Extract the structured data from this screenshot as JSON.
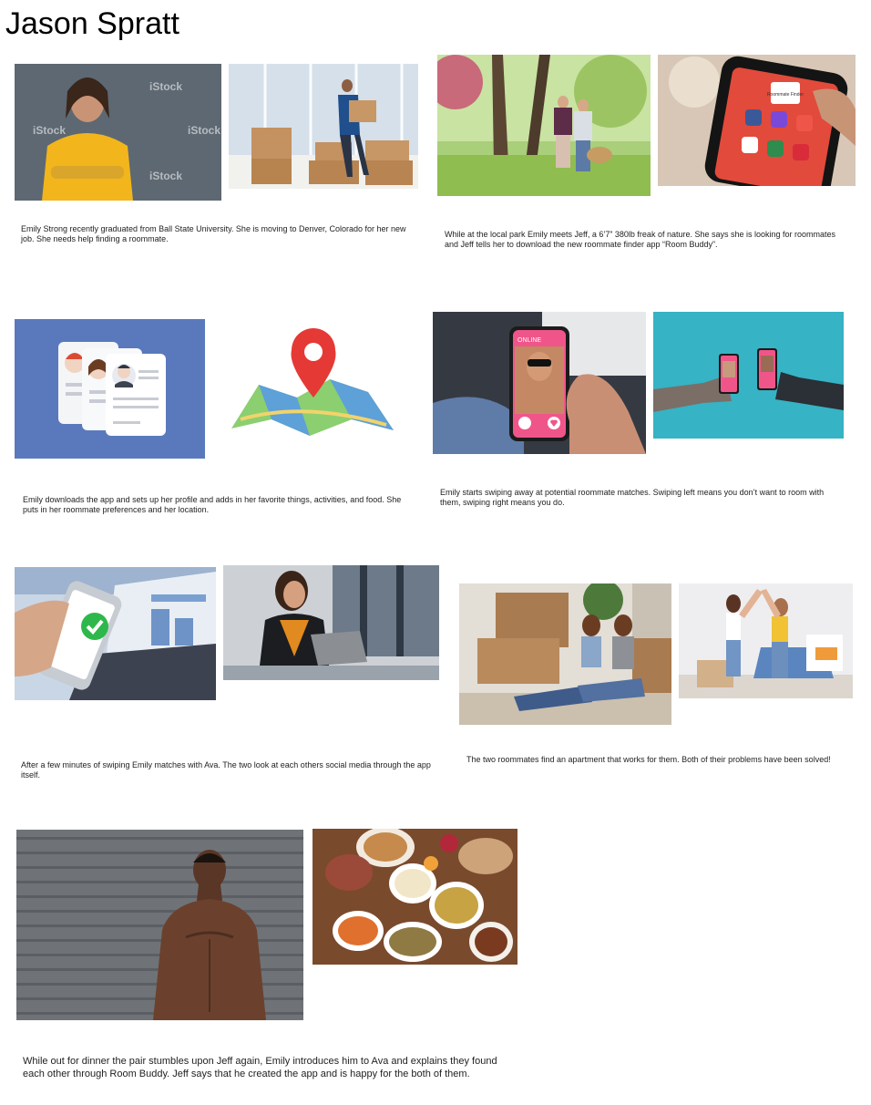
{
  "page": {
    "title": "Jason Spratt"
  },
  "watermark": "iStock",
  "captions": {
    "scene1": "Emily Strong recently graduated from Ball State University. She is moving to Denver, Colorado for her new job. She needs help finding a roommate.",
    "scene2": "While at the local park Emily meets Jeff, a 6’7” 380lb freak of nature. She says she is looking for roommates and Jeff tells her to download the new roommate finder app “Room Buddy”.",
    "scene3": "Emily downloads the app and sets up her profile and adds in her favorite things, activities, and food. She puts in her roommate preferences and her location.",
    "scene4": "Emily starts swiping away at potential roommate matches. Swiping left means you don’t want to room with them, swiping right means you do.",
    "scene5": "After a few minutes of swiping Emily matches with Ava. The two look at each others social media through the app itself.",
    "scene6": "The two roommates find an apartment that works for them. Both of their problems have been solved!",
    "scene7": "While out for dinner the pair stumbles upon Jeff again, Emily introduces him to Ava and explains they found each other through Room Buddy. Jeff says that he created the app and is happy for the both of them."
  },
  "images": {
    "phone_screen_label": "Roommate Finder",
    "swipe_badge": "ONLINE"
  },
  "colors": {
    "profile_bg": "#5a79bd",
    "map_pin": "#e53935",
    "match_check": "#2eb84b",
    "app_pink": "#f0558a",
    "teal_bg": "#36b3c4"
  }
}
